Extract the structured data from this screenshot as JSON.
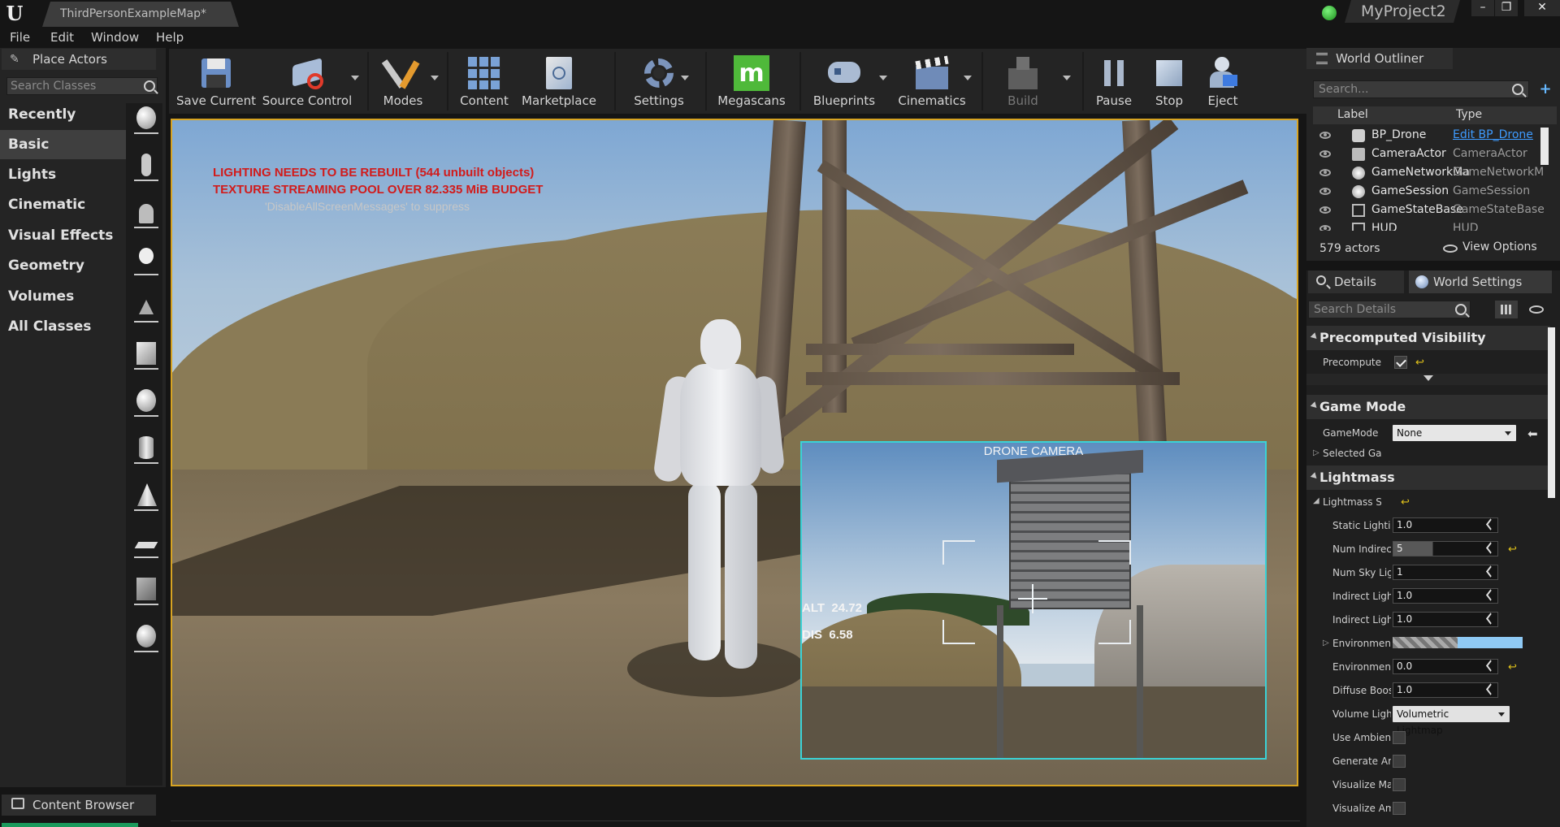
{
  "titlebar": {
    "doc_tab": "ThirdPersonExampleMap*",
    "project": "MyProject2"
  },
  "menu": {
    "items": [
      "File",
      "Edit",
      "Window",
      "Help"
    ]
  },
  "place_actors": {
    "tab_label": "Place Actors",
    "search_placeholder": "Search Classes",
    "categories": [
      "Recently Placed",
      "Basic",
      "Lights",
      "Cinematic",
      "Visual Effects",
      "Geometry",
      "Volumes",
      "All Classes"
    ],
    "active_category": "Basic"
  },
  "toolbar": {
    "save_current": "Save Current",
    "source_control": "Source Control",
    "modes": "Modes",
    "content": "Content",
    "marketplace": "Marketplace",
    "settings": "Settings",
    "megascans": "Megascans",
    "blueprints": "Blueprints",
    "cinematics": "Cinematics",
    "build": "Build",
    "pause": "Pause",
    "stop": "Stop",
    "eject": "Eject"
  },
  "viewport": {
    "warning_1": "LIGHTING NEEDS TO BE REBUILT (544 unbuilt objects)",
    "warning_2": "TEXTURE STREAMING POOL OVER 82.335 MiB BUDGET",
    "suppress_hint": "'DisableAllScreenMessages' to suppress"
  },
  "drone_camera": {
    "title": "DRONE CAMERA",
    "alt_label": "ALT",
    "alt_value": "24.72",
    "dis_label": "DIS",
    "dis_value": "6.58"
  },
  "content_browser": {
    "tab_label": "Content Browser"
  },
  "outliner": {
    "tab_label": "World Outliner",
    "search_placeholder": "Search...",
    "col_label": "Label",
    "col_type": "Type",
    "rows": [
      {
        "label": "BP_Drone",
        "type": "Edit BP_Drone"
      },
      {
        "label": "CameraActor",
        "type": "CameraActor"
      },
      {
        "label": "GameNetworkManager",
        "type": "GameNetworkManager"
      },
      {
        "label": "GameSession",
        "type": "GameSession"
      },
      {
        "label": "GameStateBase",
        "type": "GameStateBase"
      },
      {
        "label": "HUD",
        "type": "HUD"
      }
    ],
    "actor_count": "579 actors",
    "view_options": "View Options"
  },
  "details": {
    "tab_details": "Details",
    "tab_world_settings": "World Settings",
    "search_placeholder": "Search Details",
    "sections": {
      "precomputed": "Precomputed Visibility",
      "game_mode": "Game Mode",
      "lightmass": "Lightmass"
    },
    "props": {
      "precompute": "Precompute Visibility",
      "gamemode_override": "GameMode Override",
      "gamemode_value": "None",
      "selected_gamemode": "Selected GameMode",
      "lightmass_settings": "Lightmass Settings",
      "static_lighting": "Static Lighting Level Scale",
      "static_lighting_value": "1.0",
      "num_indirect": "Num Indirect Lighting Bounces",
      "num_indirect_value": "5",
      "num_sky": "Num Sky Lighting Bounces",
      "num_sky_value": "1",
      "indirect_quality": "Indirect Lighting Quality",
      "indirect_quality_value": "1.0",
      "indirect_smooth": "Indirect Lighting Smoothness",
      "indirect_smooth_value": "1.0",
      "env_color": "Environment Color",
      "env_intensity": "Environment Intensity",
      "env_intensity_value": "0.0",
      "diffuse_boost": "Diffuse Boost",
      "diffuse_boost_value": "1.0",
      "volume_lighting": "Volume Lighting Method",
      "volume_lighting_value": "Volumetric Lightmap",
      "use_ambient": "Use Ambient Occlusion",
      "generate_ambient": "Generate Ambient Occlusion Material Mask",
      "visualize_material": "Visualize Material Diffuse",
      "visualize_ambient": "Visualize Ambient Occlusion"
    }
  },
  "colors": {
    "viewport_border": "#d8a422",
    "drone_border": "#3ad2d6",
    "warning": "#d11b1b",
    "megascans": "#4fb93a",
    "link": "#3e9bff",
    "reset_arrow": "#e0c21a"
  }
}
